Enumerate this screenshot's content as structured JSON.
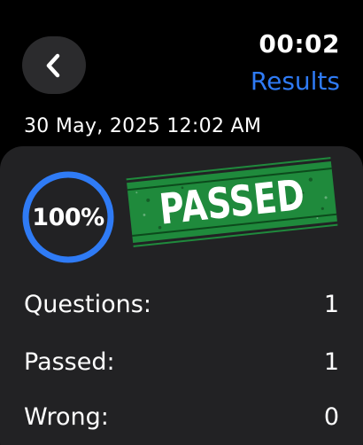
{
  "header": {
    "time": "00:02",
    "title": "Results",
    "back_icon": "chevron-left-icon"
  },
  "session": {
    "datetime": "30 May, 2025 12:02 AM"
  },
  "result": {
    "score": "100%",
    "score_fraction": 1.0,
    "stamp_label": "PASSED",
    "ring_color": "#2f7bf5",
    "stamp_color": "#1f8a3c"
  },
  "stats": [
    {
      "label": "Questions:",
      "value": "1"
    },
    {
      "label": "Passed:",
      "value": "1"
    },
    {
      "label": "Wrong:",
      "value": "0"
    }
  ],
  "colors": {
    "accent": "#2f7bf5",
    "background": "#000000",
    "card": "#222224"
  }
}
